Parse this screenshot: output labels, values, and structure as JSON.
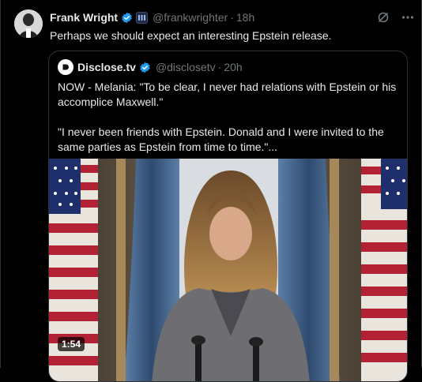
{
  "post": {
    "author_name": "Frank Wright",
    "author_handle": "@frankwrighter",
    "separator": "·",
    "time": "18h",
    "text": "Perhaps we should expect an interesting Epstein release."
  },
  "quoted": {
    "author_name": "Disclose.tv",
    "author_handle": "@disclosetv",
    "separator": "·",
    "time": "20h",
    "paragraph_1": "NOW - Melania: \"To be clear, I never had relations with Epstein or his accomplice Maxwell.\"",
    "paragraph_2": "\"I never been friends with Epstein. Donald and I were invited to the same parties as Epstein from time to time.\"...",
    "video_duration": "1:54"
  },
  "icons": {
    "verified": "verified-badge-icon",
    "affiliation": "affiliation-badge-icon",
    "grok": "grok-icon",
    "more": "more-icon"
  },
  "colors": {
    "background": "#000000",
    "text": "#e7e9ea",
    "secondary": "#71767b",
    "border": "#2f3336",
    "verified": "#1d9bf0"
  }
}
